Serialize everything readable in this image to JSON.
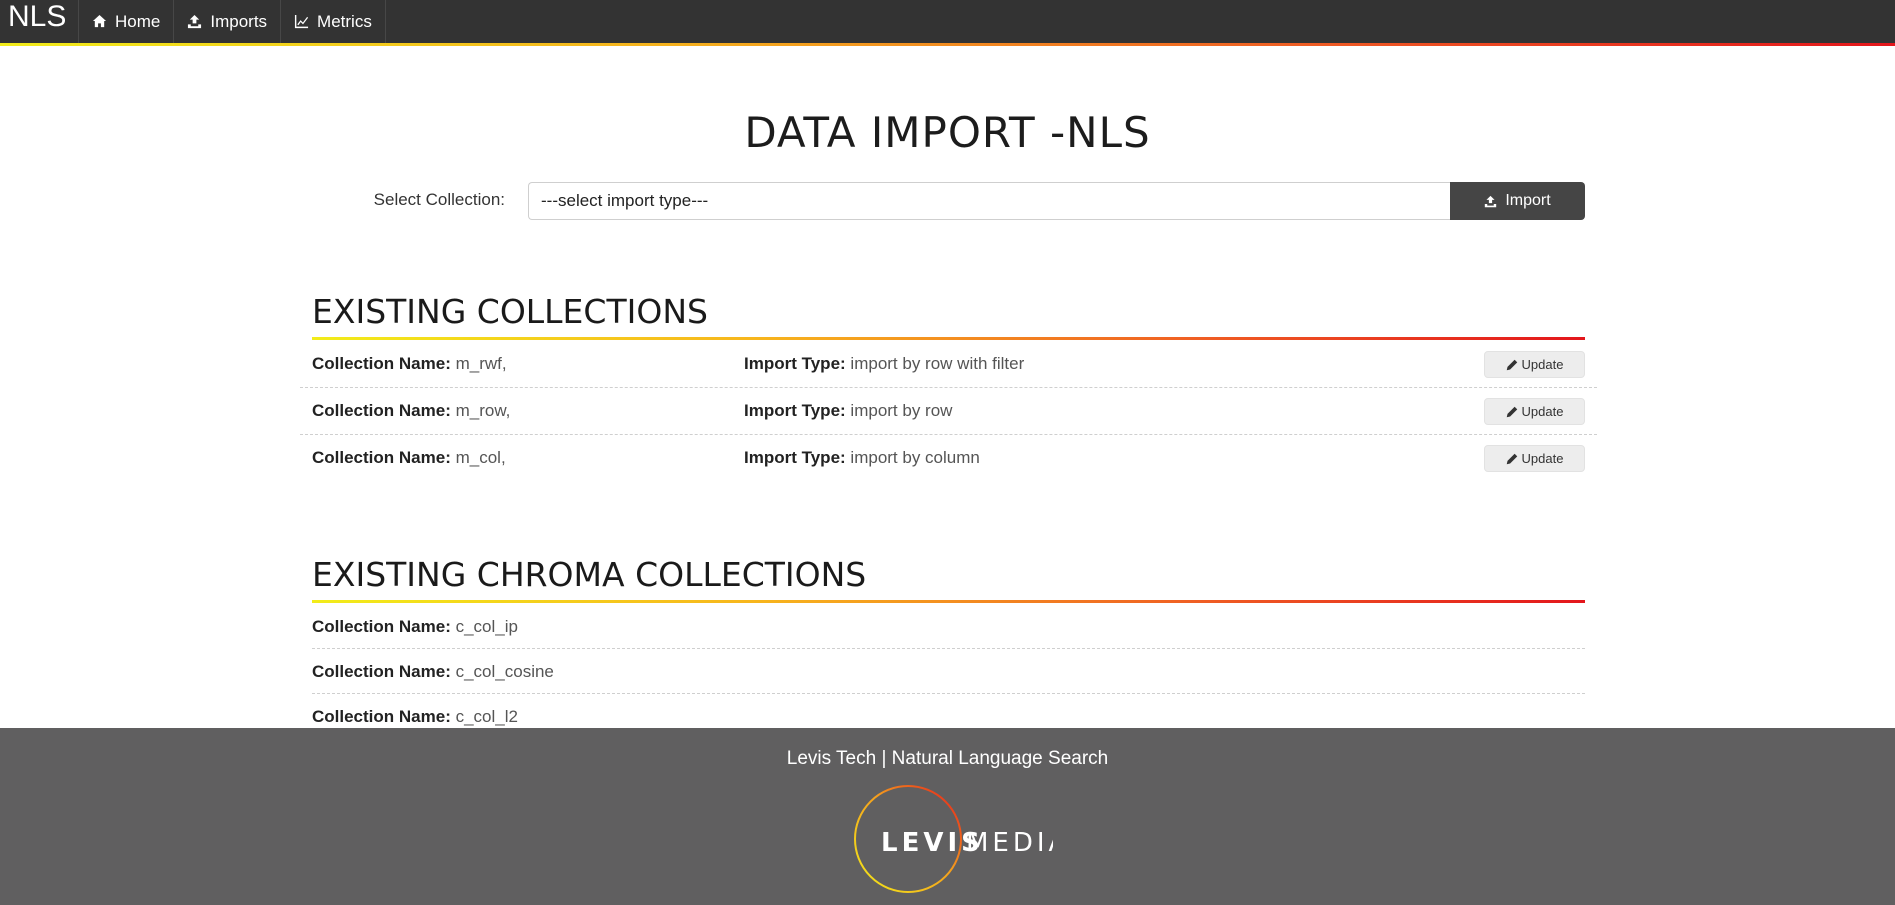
{
  "navbar": {
    "brand": "NLS",
    "items": [
      {
        "label": "Home",
        "icon": "home-icon"
      },
      {
        "label": "Imports",
        "icon": "upload-icon"
      },
      {
        "label": "Metrics",
        "icon": "line-chart-icon"
      }
    ]
  },
  "page": {
    "title": "DATA IMPORT -NLS"
  },
  "import_form": {
    "label": "Select Collection:",
    "selected": "---select import type---",
    "button_label": "Import"
  },
  "existing": {
    "title": "EXISTING COLLECTIONS",
    "name_label": "Collection Name:",
    "type_label": "Import Type:",
    "update_label": "Update",
    "rows": [
      {
        "name": "m_rwf,",
        "type": "import by row with filter"
      },
      {
        "name": "m_row,",
        "type": "import by row"
      },
      {
        "name": "m_col,",
        "type": "import by column"
      }
    ]
  },
  "chroma": {
    "title": "EXISTING CHROMA COLLECTIONS",
    "name_label": "Collection Name:",
    "rows": [
      {
        "name": "c_col_ip"
      },
      {
        "name": "c_col_cosine"
      },
      {
        "name": "c_col_l2"
      }
    ]
  },
  "footer": {
    "text": "Levis Tech | Natural Language Search",
    "logo_left": "LEVIS",
    "logo_right": "MEDIA"
  },
  "colors": {
    "navbar_bg": "#333333",
    "footer_bg": "#605f60",
    "gradient_start": "#f2ec1a",
    "gradient_end": "#e3161c"
  }
}
